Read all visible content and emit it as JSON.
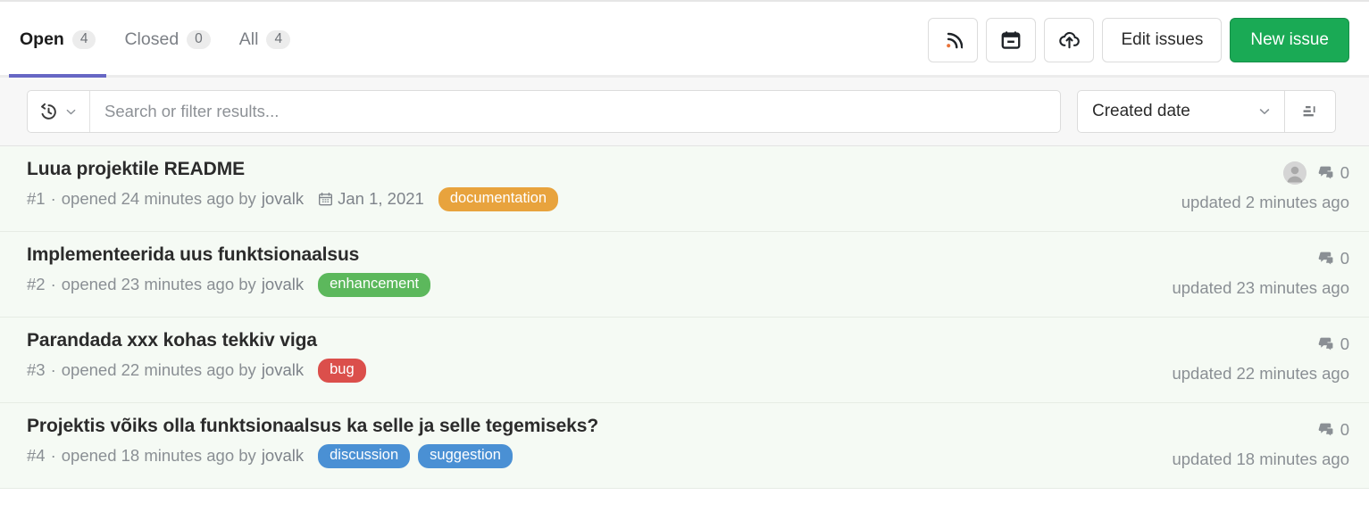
{
  "tabs": [
    {
      "label": "Open",
      "count": "4",
      "active": true,
      "name": "tab-open"
    },
    {
      "label": "Closed",
      "count": "0",
      "active": false,
      "name": "tab-closed"
    },
    {
      "label": "All",
      "count": "4",
      "active": false,
      "name": "tab-all"
    }
  ],
  "actions": {
    "rss_icon": "rss-icon",
    "calendar_icon": "calendar-icon",
    "export_icon": "cloud-upload-icon",
    "edit_issues_label": "Edit issues",
    "new_issue_label": "New issue"
  },
  "filter": {
    "history_icon": "history-icon",
    "chevron_icon": "chevron-down-icon",
    "search_placeholder": "Search or filter results...",
    "search_value": "",
    "sort_value": "Created date",
    "sort_direction_icon": "sort-descending-icon"
  },
  "colors": {
    "accent_tab": "#6666c4",
    "primary_button": "#1aaa55",
    "row_background": "#f5faf4",
    "label_documentation": "#e8a33d",
    "label_enhancement": "#5cb85c",
    "label_bug": "#db4f4b",
    "label_discussion": "#4a90d4",
    "label_suggestion": "#4a90d4"
  },
  "issues": [
    {
      "title": "Luua projektile README",
      "number": "#1",
      "separator": "·",
      "opened": "opened 24 minutes ago by",
      "author": "jovalk",
      "milestone": "Jan 1, 2021",
      "has_milestone": true,
      "labels": [
        {
          "text": "documentation",
          "color": "#e8a33d"
        }
      ],
      "has_avatar": true,
      "comments": "0",
      "updated": "updated 2 minutes ago"
    },
    {
      "title": "Implementeerida uus funktsionaalsus",
      "number": "#2",
      "separator": "·",
      "opened": "opened 23 minutes ago by",
      "author": "jovalk",
      "milestone": "",
      "has_milestone": false,
      "labels": [
        {
          "text": "enhancement",
          "color": "#5cb85c"
        }
      ],
      "has_avatar": false,
      "comments": "0",
      "updated": "updated 23 minutes ago"
    },
    {
      "title": "Parandada xxx kohas tekkiv viga",
      "number": "#3",
      "separator": "·",
      "opened": "opened 22 minutes ago by",
      "author": "jovalk",
      "milestone": "",
      "has_milestone": false,
      "labels": [
        {
          "text": "bug",
          "color": "#db4f4b"
        }
      ],
      "has_avatar": false,
      "comments": "0",
      "updated": "updated 22 minutes ago"
    },
    {
      "title": "Projektis võiks olla funktsionaalsus ka selle ja selle tegemiseks?",
      "number": "#4",
      "separator": "·",
      "opened": "opened 18 minutes ago by",
      "author": "jovalk",
      "milestone": "",
      "has_milestone": false,
      "labels": [
        {
          "text": "discussion",
          "color": "#4a90d4"
        },
        {
          "text": "suggestion",
          "color": "#4a90d4"
        }
      ],
      "has_avatar": false,
      "comments": "0",
      "updated": "updated 18 minutes ago"
    }
  ]
}
